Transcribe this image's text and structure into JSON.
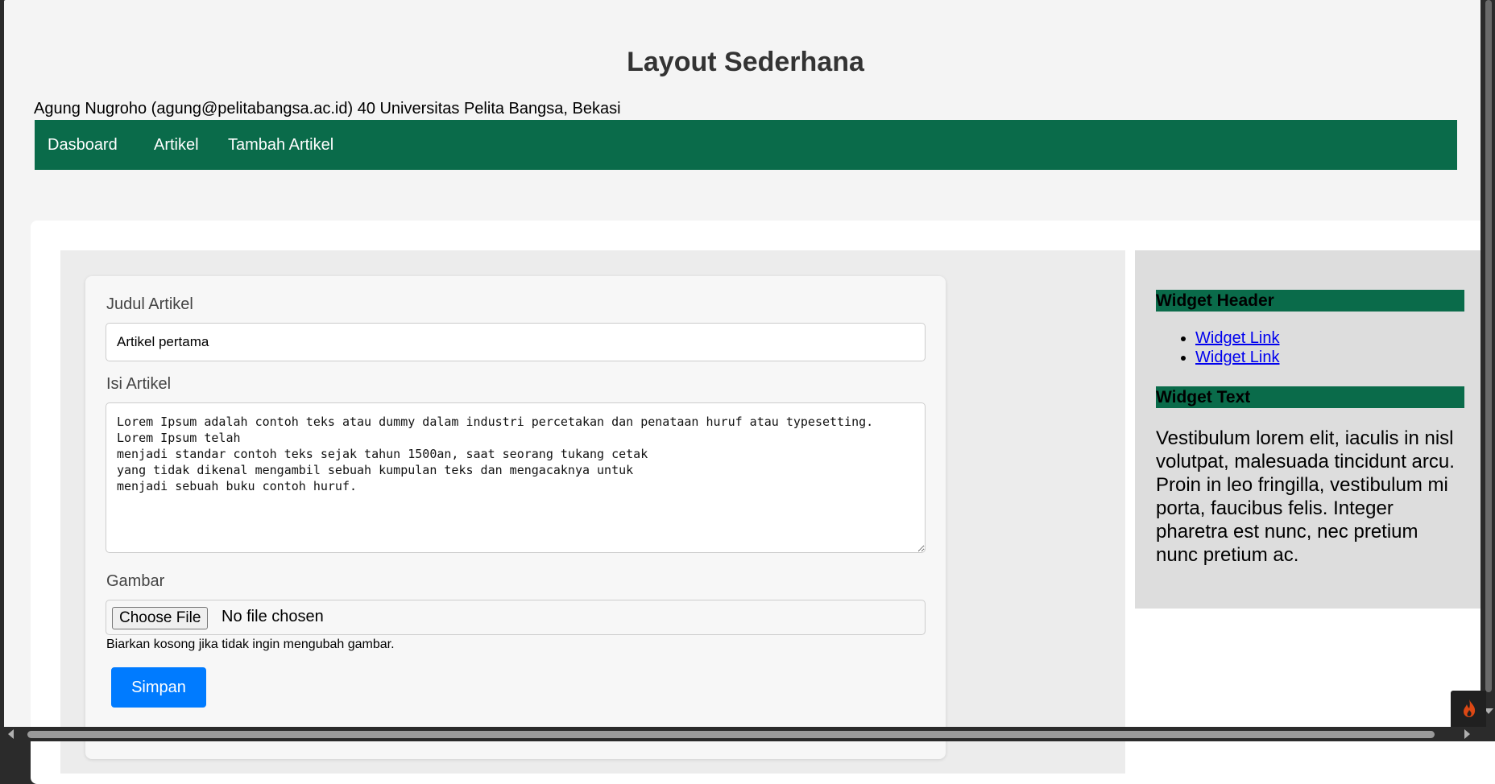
{
  "header": {
    "title": "Layout Sederhana",
    "author_line": "Agung Nugroho (agung@pelitabangsa.ac.id) 40 Universitas Pelita Bangsa, Bekasi"
  },
  "nav": {
    "items": [
      {
        "label": "Dasboard"
      },
      {
        "label": "Artikel"
      },
      {
        "label": "Tambah Artikel"
      }
    ]
  },
  "form": {
    "title_label": "Judul Artikel",
    "title_value": "Artikel pertama",
    "content_label": "Isi Artikel",
    "content_value": "Lorem Ipsum adalah contoh teks atau dummy dalam industri percetakan dan penataan huruf atau typesetting. Lorem Ipsum telah\nmenjadi standar contoh teks sejak tahun 1500an, saat seorang tukang cetak\nyang tidak dikenal mengambil sebuah kumpulan teks dan mengacaknya untuk\nmenjadi sebuah buku contoh huruf.",
    "image_label": "Gambar",
    "choose_file_label": "Choose File",
    "file_status": "No file chosen",
    "image_hint": "Biarkan kosong jika tidak ingin mengubah gambar.",
    "save_label": "Simpan"
  },
  "sidebar": {
    "widget_header_title": "Widget Header",
    "links": [
      {
        "label": "Widget Link"
      },
      {
        "label": "Widget Link"
      }
    ],
    "widget_text_title": "Widget Text",
    "widget_text_body": "Vestibulum lorem elit, iaculis in nisl volutpat, malesuada tincidunt arcu. Proin in leo fringilla, vestibulum mi porta, faucibus felis. Integer pharetra est nunc, nec pretium nunc pretium ac."
  },
  "debug_toolbar": {
    "icon": "flame-icon"
  },
  "colors": {
    "nav_background": "#0a6b4a",
    "widget_header_background": "#0a6b4a",
    "primary_button": "#007bff",
    "page_background": "#f4f4f4",
    "sidebar_background": "#dddddd"
  }
}
